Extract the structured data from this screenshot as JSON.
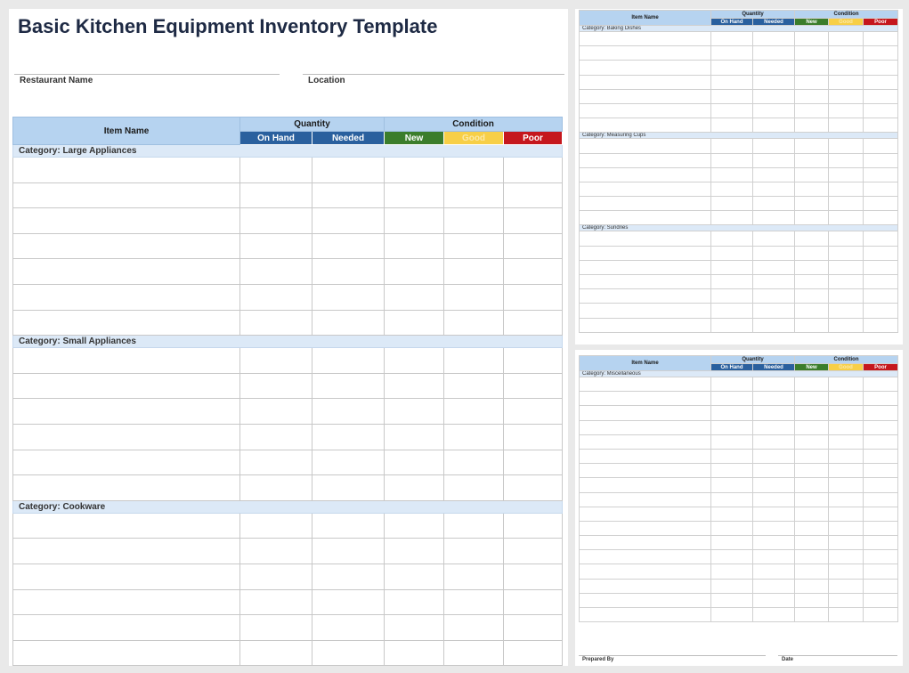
{
  "title": "Basic Kitchen Equipment Inventory Template",
  "fields": {
    "restaurant_name": "Restaurant Name",
    "location": "Location"
  },
  "header": {
    "item_name": "Item Name",
    "quantity": "Quantity",
    "condition": "Condition",
    "on_hand": "On Hand",
    "needed": "Needed",
    "new": "New",
    "good": "Good",
    "poor": "Poor"
  },
  "categories": {
    "large_appliances": "Category: Large Appliances",
    "small_appliances": "Category: Small Appliances",
    "cookware": "Category: Cookware",
    "baking_dishes": "Category: Baking Dishes",
    "measuring_cups": "Category: Measuring Cups",
    "sundries": "Category: Sundries",
    "miscellaneous": "Category: Miscellaneous"
  },
  "footer": {
    "prepared_by": "Prepared By",
    "date": "Date"
  },
  "colors": {
    "header_blue": "#b6d3f0",
    "quantity_blue": "#2a609e",
    "new_green": "#3b7d2b",
    "good_yellow": "#f7cf47",
    "poor_red": "#c5171d",
    "category_band": "#dce9f7",
    "title_navy": "#1e2a44"
  }
}
